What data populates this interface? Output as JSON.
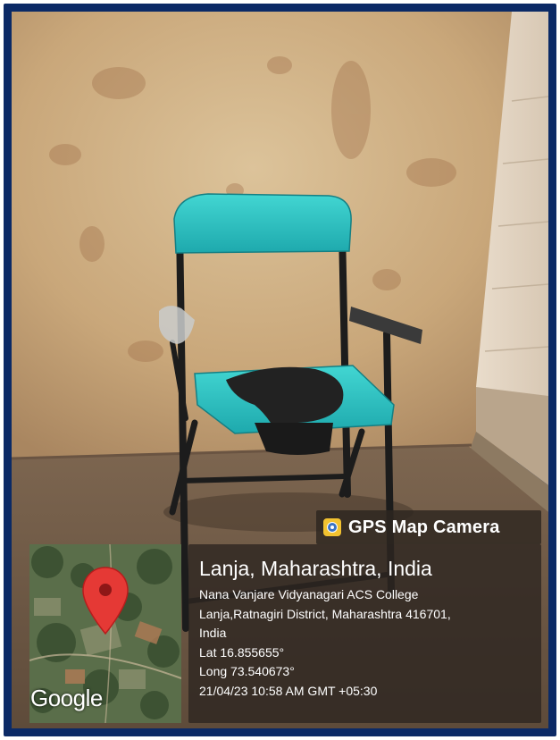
{
  "overlay": {
    "badge_label": "GPS Map Camera",
    "badge_icon": "gps-map-camera-app-icon",
    "location_title": "Lanja, Maharashtra, India",
    "address_line_1": "Nana Vanjare Vidyanagari ACS College",
    "address_line_2": "Lanja,Ratnagiri District, Maharashtra 416701,",
    "address_line_3": "India",
    "latitude": "Lat 16.855655°",
    "longitude": "Long 73.540673°",
    "datetime": "21/04/23 10:58 AM GMT +05:30"
  },
  "map": {
    "provider_label": "Google",
    "pin_icon": "map-pin-icon",
    "pin_color": "#e53935"
  },
  "photo": {
    "subject": "commode-chair-icon",
    "seat_color": "#2ec4c4",
    "frame_color": "#1c1c1c",
    "border_color": "#0b2a66"
  }
}
